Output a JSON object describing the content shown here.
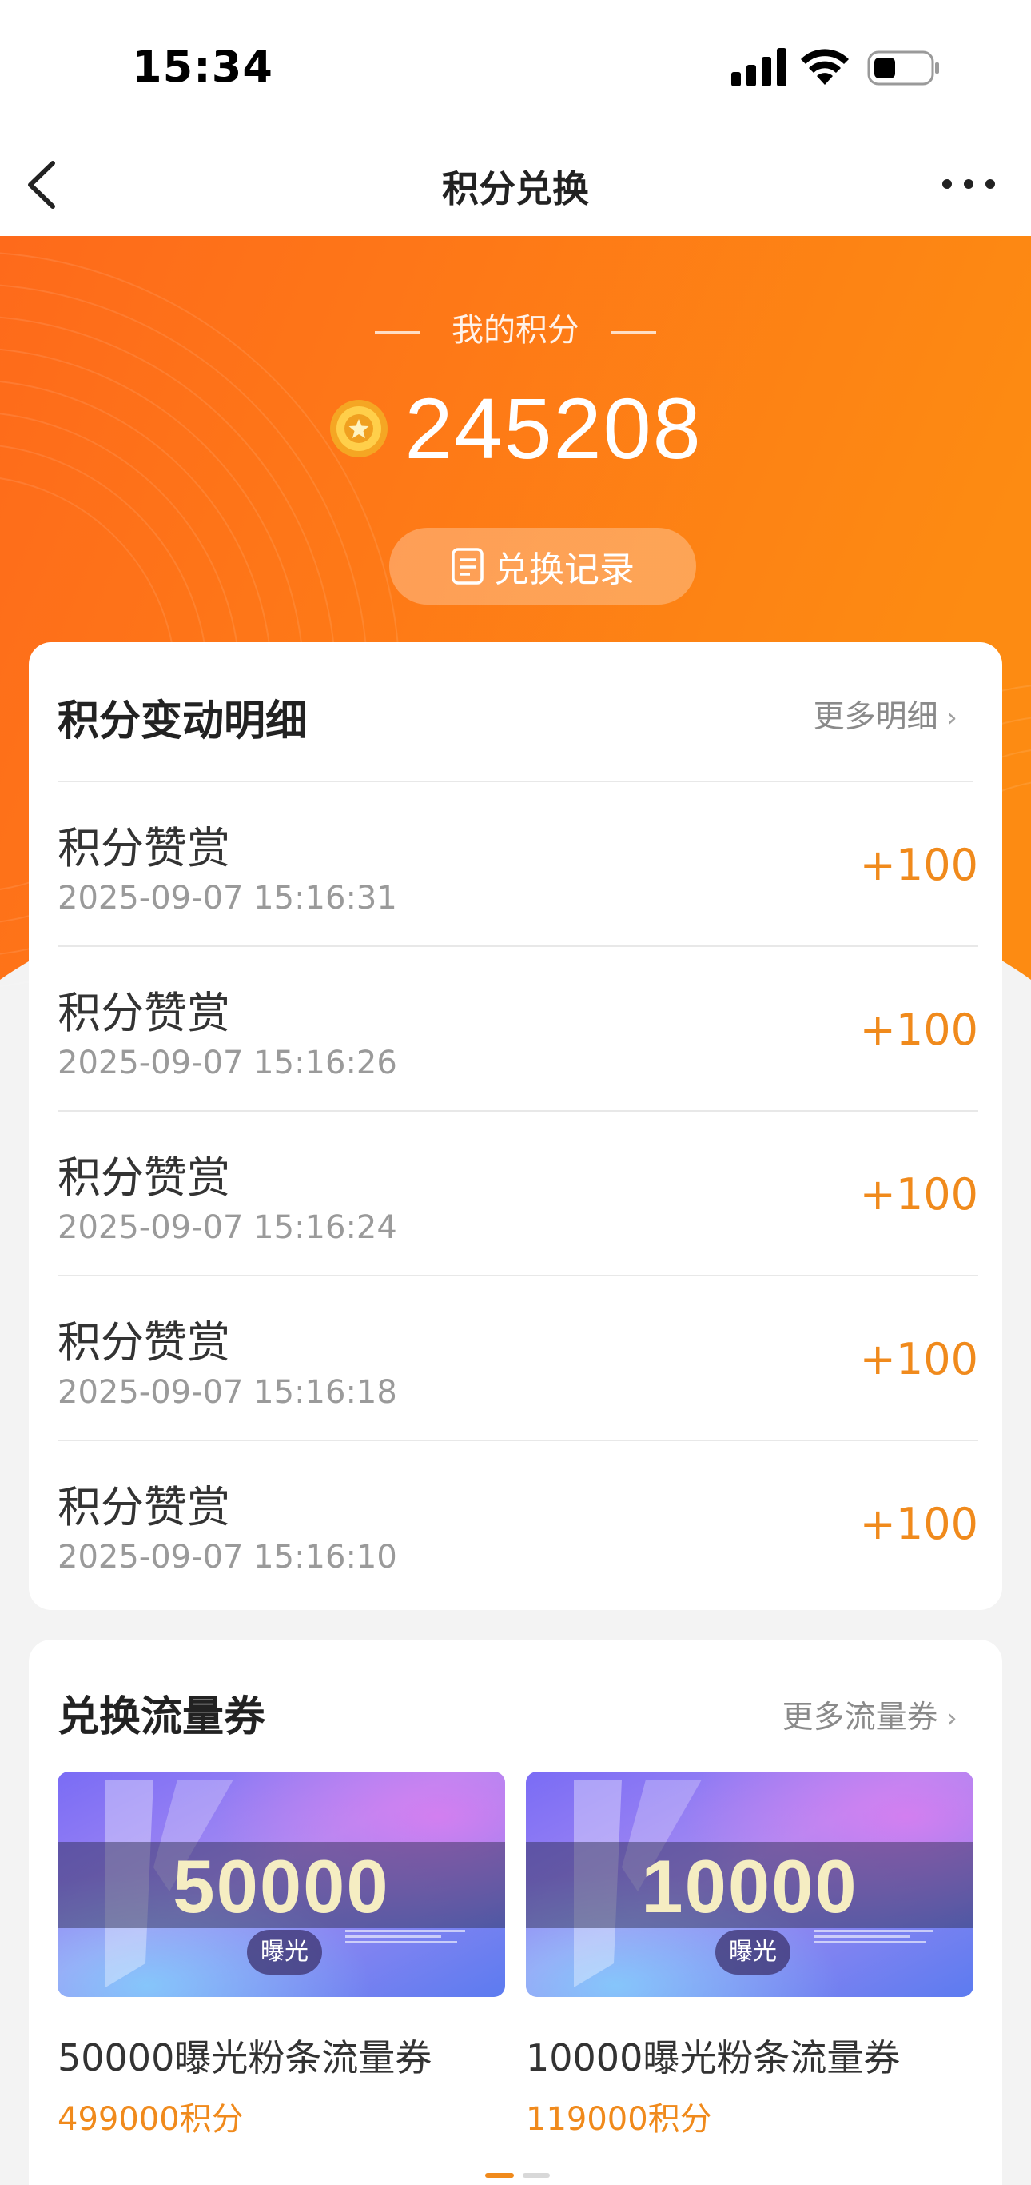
{
  "status_bar": {
    "time": "15:34"
  },
  "nav": {
    "title": "积分兑换",
    "back_icon": "chevron-left-icon",
    "more_icon": "ellipsis-icon"
  },
  "hero": {
    "label": "我的积分",
    "points": "245208",
    "record_button": "兑换记录",
    "colors": {
      "start": "#fe6a1b",
      "end": "#fd8b12"
    }
  },
  "detail": {
    "title": "积分变动明细",
    "more": "更多明细",
    "rows": [
      {
        "title": "积分赞赏",
        "time": "2025-09-07 15:16:31",
        "amount": "+100"
      },
      {
        "title": "积分赞赏",
        "time": "2025-09-07 15:16:26",
        "amount": "+100"
      },
      {
        "title": "积分赞赏",
        "time": "2025-09-07 15:16:24",
        "amount": "+100"
      },
      {
        "title": "积分赞赏",
        "time": "2025-09-07 15:16:18",
        "amount": "+100"
      },
      {
        "title": "积分赞赏",
        "time": "2025-09-07 15:16:10",
        "amount": "+100"
      }
    ]
  },
  "coupons": {
    "title": "兑换流量券",
    "more": "更多流量券",
    "items": [
      {
        "big": "50000",
        "tag": "曝光",
        "name": "50000曝光粉条流量券",
        "price": "499000积分"
      },
      {
        "big": "10000",
        "tag": "曝光",
        "name": "10000曝光粉条流量券",
        "price": "119000积分"
      }
    ]
  },
  "accent_color": "#f08a1c"
}
